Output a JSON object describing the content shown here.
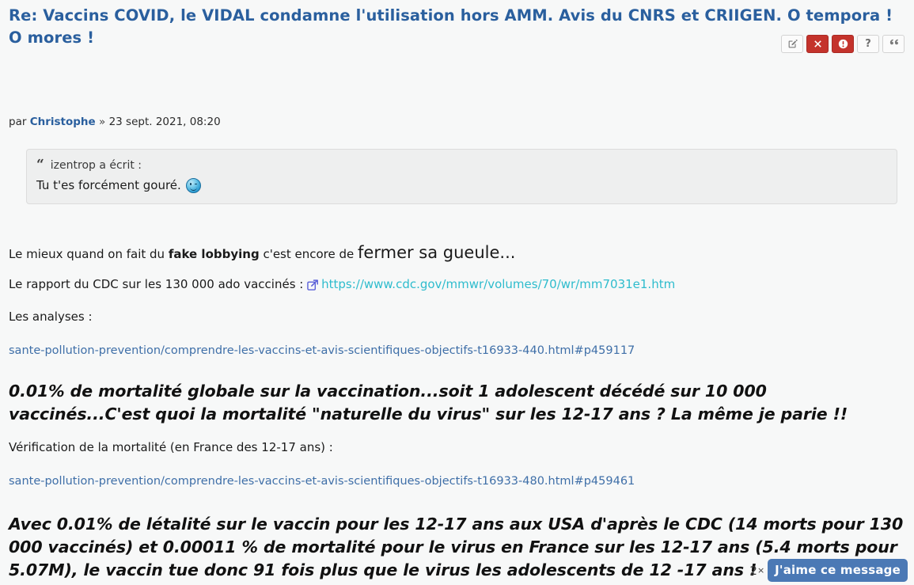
{
  "post": {
    "title": "Re: Vaccins COVID, le VIDAL condamne l'utilisation hors AMM. Avis du CNRS et CRIIGEN. O tempora ! O mores !",
    "author_prefix": "par",
    "author": "Christophe",
    "separator": "»",
    "timestamp": "23 sept. 2021, 08:20"
  },
  "actions": [
    {
      "name": "edit-button",
      "label": "Éditer",
      "icon": "pencil-square-icon",
      "style": "default"
    },
    {
      "name": "delete-button",
      "label": "Supprimer",
      "icon": "close-icon",
      "style": "danger"
    },
    {
      "name": "report-button",
      "label": "Signaler",
      "icon": "warning-icon",
      "style": "danger"
    },
    {
      "name": "help-button",
      "label": "?",
      "icon": "question-mark-icon",
      "style": "default"
    },
    {
      "name": "quote-button",
      "label": "“",
      "icon": "quote-icon",
      "style": "default"
    }
  ],
  "quote": {
    "mark": "“",
    "header": "izentrop a écrit :",
    "text": "Tu t'es forcément gouré.",
    "emoticon": "wink-smiley-icon"
  },
  "body": {
    "p1_prefix": "Le mieux quand on fait du ",
    "p1_bold": "fake lobbying",
    "p1_mid": " c'est encore de ",
    "p1_big": "fermer sa gueule...",
    "p2_prefix": "Le rapport du CDC sur les 130 000 ado vaccinés : ",
    "p2_link": "https://www.cdc.gov/mmwr/volumes/70/wr/mm7031e1.htm",
    "p3": "Les analyses :",
    "link1": "sante-pollution-prevention/comprendre-les-vaccins-et-avis-scientifiques-objectifs-t16933-440.html#p459117",
    "shout1": "0.01% de mortalité globale sur la vaccination...soit 1 adolescent décédé sur 10 000 vaccinés...C'est quoi la mortalité \"naturelle du virus\" sur les 12-17 ans ? La même je parie !!",
    "p4": "Vérification de la mortalité (en France des 12-17 ans) :",
    "link2": "sante-pollution-prevention/comprendre-les-vaccins-et-avis-scientifiques-objectifs-t16933-480.html#p459461",
    "shout2": "Avec 0.01% de létalité sur le vaccin pour les 12-17 ans aux USA d'après le CDC (14 morts pour 130 000 vaccinés) et 0.00011 % de mortalité pour le virus en France sur les 12-17 ans (5.4 morts pour 5.07M), le vaccin tue donc 91 fois plus que le virus les adolescents de 12 -17 ans !"
  },
  "like": {
    "count": "2",
    "multiplier": "×",
    "label": "J'aime ce message"
  },
  "colors": {
    "title": "#2a5f9e",
    "internal_link": "#3f6fa8",
    "external_link": "#2ebccd",
    "danger_button": "#c4332c",
    "like_button": "#4b79b5",
    "quote_background": "#eeefef",
    "page_background": "#f7f8f8"
  }
}
